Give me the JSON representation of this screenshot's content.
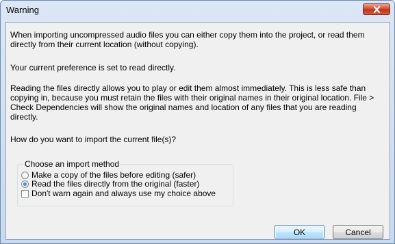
{
  "window": {
    "title": "Warning"
  },
  "message": {
    "p1": "When importing uncompressed audio files you can either copy them into the project, or read them directly from their current location (without copying).",
    "p2": "Your current preference is set to read directly.",
    "p3": "Reading the files directly allows you to play or edit them almost immediately.  This is less safe than copying in, because you must retain the files with their original names in their original location. File > Check Dependencies will show the original names and location of any files that you are reading directly.",
    "p4": "How do you want to import the current file(s)?"
  },
  "import_method": {
    "group_label": "Choose an import method",
    "options": [
      {
        "label": "Make a copy of the files before editing (safer)",
        "selected": false
      },
      {
        "label": "Read the files directly from the original (faster)",
        "selected": true
      }
    ],
    "dont_warn": {
      "label": "Don't warn again and always use my choice above",
      "checked": false
    }
  },
  "buttons": {
    "ok": "OK",
    "cancel": "Cancel"
  },
  "colors": {
    "close_button": "#c9452b",
    "radio_selected": "#1f5fae",
    "default_button_border": "#3c7fb1"
  }
}
